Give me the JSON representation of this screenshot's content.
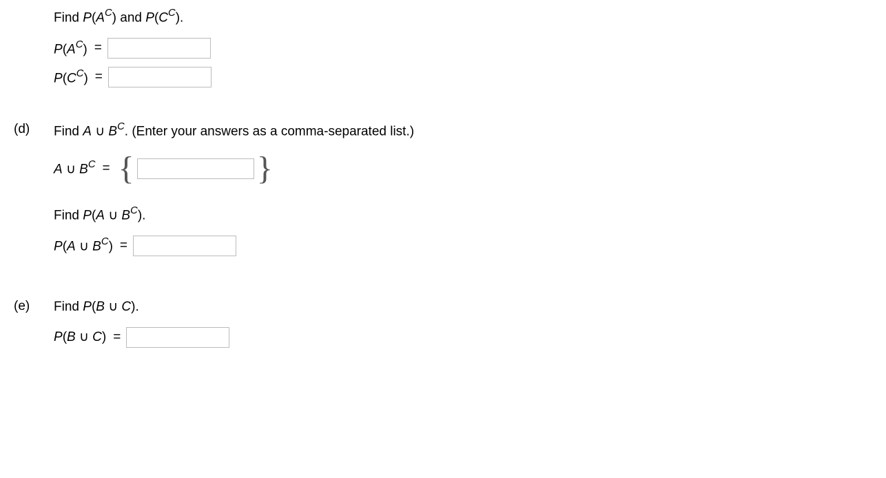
{
  "sectionTop": {
    "prompt_prefix": "Find ",
    "prompt_p_open": "P",
    "prompt_paren_open": "(",
    "prompt_A": "A",
    "prompt_supC": "C",
    "prompt_paren_close": ")",
    "prompt_and": " and ",
    "prompt_C": "C",
    "prompt_end": ".",
    "line1_label_P": "P",
    "line1_label_open": "(",
    "line1_label_A": "A",
    "line1_label_sup": "C",
    "line1_label_close": ")",
    "line1_eq": "=",
    "line2_label_P": "P",
    "line2_label_open": "(",
    "line2_label_C": "C",
    "line2_label_sup": "C",
    "line2_label_close": ")",
    "line2_eq": "="
  },
  "partD": {
    "label": "(d)",
    "prompt_prefix": "Find ",
    "prompt_A": "A",
    "prompt_union": " ∪ ",
    "prompt_B": "B",
    "prompt_sup": "C",
    "prompt_period": ".",
    "prompt_hint": " (Enter your answers as a comma-separated list.)",
    "line1_A": "A",
    "line1_union": " ∪ ",
    "line1_B": "B",
    "line1_sup": "C",
    "line1_eq": "=",
    "brace_open": "{",
    "brace_close": "}",
    "line2_prefix": "Find ",
    "line2_P": "P",
    "line2_open": "(",
    "line2_A": "A",
    "line2_union": " ∪ ",
    "line2_B": "B",
    "line2_sup": "C",
    "line2_close": ")",
    "line2_period": ".",
    "line3_P": "P",
    "line3_open": "(",
    "line3_A": "A",
    "line3_union": " ∪ ",
    "line3_B": "B",
    "line3_sup": "C",
    "line3_close": ")",
    "line3_eq": "="
  },
  "partE": {
    "label": "(e)",
    "prompt_prefix": "Find ",
    "prompt_P": "P",
    "prompt_open": "(",
    "prompt_B": "B",
    "prompt_union": " ∪ ",
    "prompt_C": "C",
    "prompt_close": ")",
    "prompt_period": ".",
    "line1_P": "P",
    "line1_open": "(",
    "line1_B": "B",
    "line1_union": " ∪ ",
    "line1_C": "C",
    "line1_close": ")",
    "line1_eq": "="
  }
}
